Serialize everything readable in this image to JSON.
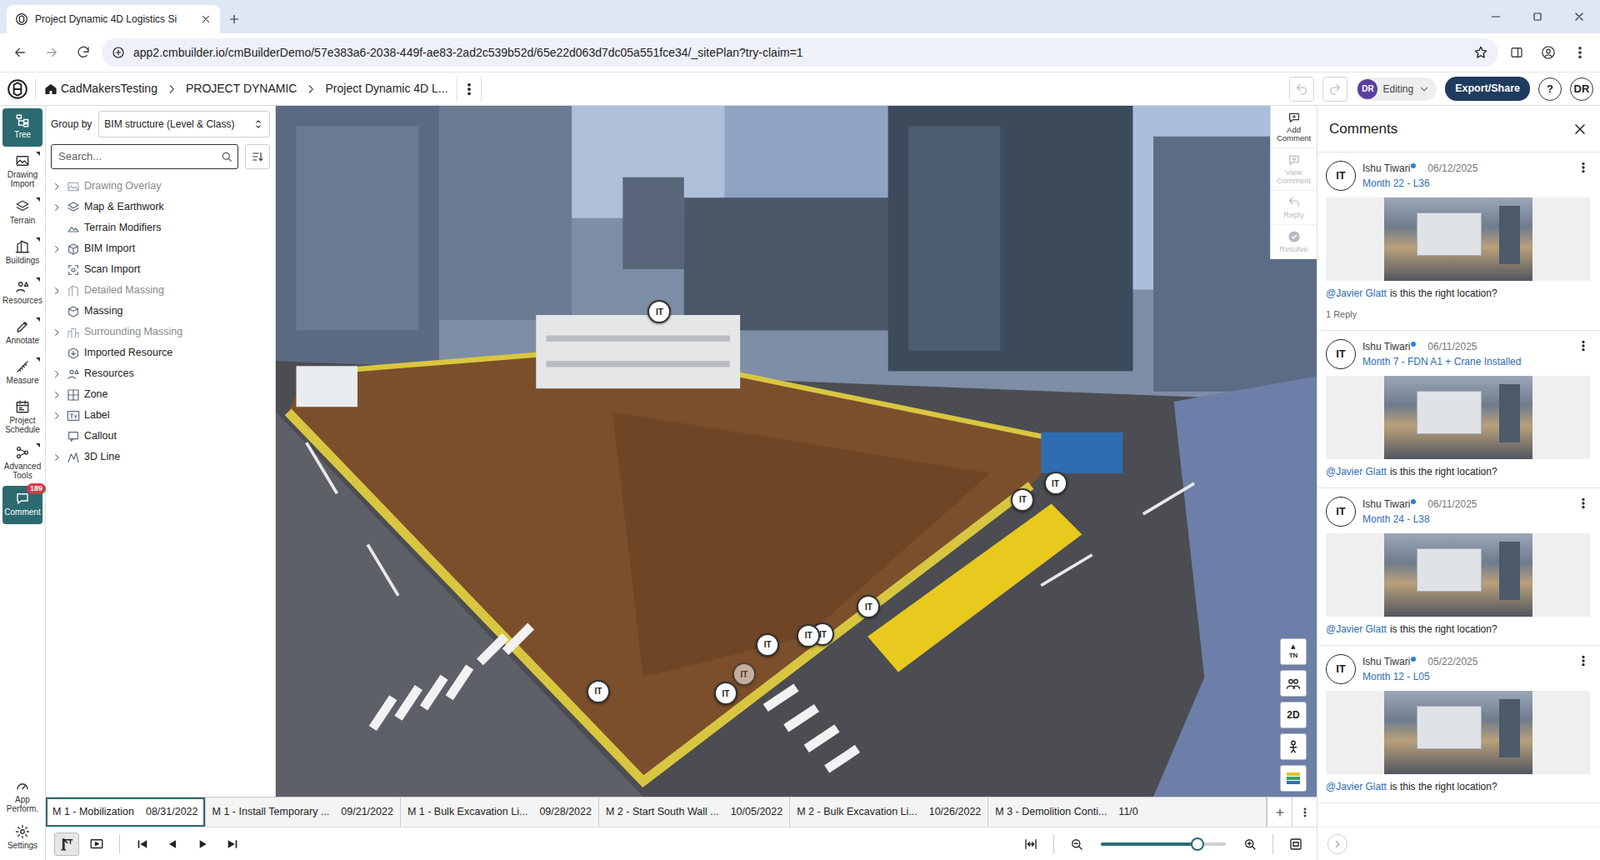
{
  "browser": {
    "tab": {
      "title": "Project Dynamic 4D Logistics Si",
      "selected": true
    },
    "url": "app2.cmbuilder.io/cmBuilderDemo/57e383a6-2038-449f-ae83-2ad2c539b52d/65e22d063d7dc05a551fce34/_sitePlan?try-claim=1"
  },
  "header": {
    "breadcrumb": [
      "CadMakersTesting",
      "PROJECT DYNAMIC",
      "Project Dynamic 4D L..."
    ],
    "undo": {
      "disabled": true
    },
    "redo": {
      "disabled": true
    },
    "mode": {
      "initials": "DR",
      "label": "Editing"
    },
    "export_label": "Export/Share",
    "help_label": "?",
    "account_initials": "DR"
  },
  "rail": {
    "items": [
      {
        "label": "Tree",
        "selected": true,
        "has_menu": false
      },
      {
        "label": "Drawing Import",
        "selected": false,
        "has_menu": true
      },
      {
        "label": "Terrain",
        "selected": false,
        "has_menu": true
      },
      {
        "label": "Buildings",
        "selected": false,
        "has_menu": true
      },
      {
        "label": "Resources",
        "selected": false,
        "has_menu": true
      },
      {
        "label": "Annotate",
        "selected": false,
        "has_menu": true
      },
      {
        "label": "Measure",
        "selected": false,
        "has_menu": true
      },
      {
        "label": "Project Schedule",
        "selected": false,
        "has_menu": false
      },
      {
        "label": "Advanced Tools",
        "selected": false,
        "has_menu": true
      },
      {
        "label": "Comment",
        "selected": true,
        "has_menu": false,
        "badge": "189"
      }
    ],
    "bottom_items": [
      {
        "label": "App Perform.",
        "selected": false,
        "has_menu": false
      },
      {
        "label": "Settings",
        "selected": false,
        "has_menu": false
      }
    ]
  },
  "tree": {
    "group_by_label": "Group by",
    "group_by_value": "BIM structure (Level & Class)",
    "search_placeholder": "Search...",
    "items": [
      {
        "label": "Drawing Overlay",
        "expandable": true,
        "disabled": true
      },
      {
        "label": "Map & Earthwork",
        "expandable": true,
        "disabled": false
      },
      {
        "label": "Terrain Modifiers",
        "expandable": false,
        "disabled": false
      },
      {
        "label": "BIM Import",
        "expandable": true,
        "disabled": false
      },
      {
        "label": "Scan Import",
        "expandable": false,
        "disabled": false
      },
      {
        "label": "Detailed Massing",
        "expandable": true,
        "disabled": true
      },
      {
        "label": "Massing",
        "expandable": false,
        "disabled": false
      },
      {
        "label": "Surrounding Massing",
        "expandable": true,
        "disabled": true
      },
      {
        "label": "Imported Resource",
        "expandable": false,
        "disabled": false
      },
      {
        "label": "Resources",
        "expandable": true,
        "disabled": false
      },
      {
        "label": "Zone",
        "expandable": true,
        "disabled": false
      },
      {
        "label": "Label",
        "expandable": true,
        "disabled": false
      },
      {
        "label": "Callout",
        "expandable": false,
        "disabled": false
      },
      {
        "label": "3D Line",
        "expandable": true,
        "disabled": false
      }
    ]
  },
  "viewport": {
    "tools": [
      {
        "label": "Add Comment",
        "disabled": false
      },
      {
        "label": "View Comment",
        "disabled": true
      },
      {
        "label": "Reply",
        "disabled": true
      },
      {
        "label": "Resolve",
        "disabled": true
      }
    ],
    "pins": [
      {
        "label": "IT",
        "dimmed": false
      },
      {
        "label": "IT",
        "dimmed": false
      },
      {
        "label": "IT",
        "dimmed": false
      },
      {
        "label": "IT",
        "dimmed": false
      },
      {
        "label": "IT",
        "dimmed": false
      },
      {
        "label": "IT",
        "dimmed": false
      },
      {
        "label": "IT",
        "dimmed": false
      },
      {
        "label": "IT",
        "dimmed": true
      },
      {
        "label": "IT",
        "dimmed": false
      },
      {
        "label": "IT",
        "dimmed": false
      }
    ],
    "corner_buttons": [
      {
        "kind": "compass",
        "label": "TN"
      },
      {
        "kind": "icon"
      },
      {
        "kind": "text",
        "label": "2D"
      },
      {
        "kind": "icon"
      },
      {
        "kind": "icon"
      }
    ]
  },
  "comments": {
    "title": "Comments",
    "items": [
      {
        "author": "Ishu Tiwari",
        "initials": "IT",
        "online": true,
        "date": "06/12/2025",
        "subtitle": "Month 22 - L36",
        "mention": "@Javier Glatt",
        "body": "is this the right location?",
        "replies": "1 Reply"
      },
      {
        "author": "Ishu Tiwari",
        "initials": "IT",
        "online": true,
        "date": "06/11/2025",
        "subtitle": "Month 7 - FDN A1 + Crane Installed",
        "mention": "@Javier Glatt",
        "body": "is this the right location?"
      },
      {
        "author": "Ishu Tiwari",
        "initials": "IT",
        "online": true,
        "date": "06/11/2025",
        "subtitle": "Month 24 - L38",
        "mention": "@Javier Glatt",
        "body": "is this the right location?"
      },
      {
        "author": "Ishu Tiwari",
        "initials": "IT",
        "online": true,
        "date": "05/22/2025",
        "subtitle": "Month 12 - L05",
        "mention": "@Javier Glatt",
        "body": "is this the right location?"
      }
    ]
  },
  "timeline": {
    "items": [
      {
        "label": "M 1 - Mobilization",
        "date": "08/31/2022",
        "selected": true
      },
      {
        "label": "M 1 - Install Temporary ...",
        "date": "09/21/2022",
        "selected": false
      },
      {
        "label": "M 1 - Bulk Excavation Li...",
        "date": "09/28/2022",
        "selected": false
      },
      {
        "label": "M 2 - Start South Wall ...",
        "date": "10/05/2022",
        "selected": false
      },
      {
        "label": "M 2 - Bulk Excavation Li...",
        "date": "10/26/2022",
        "selected": false
      },
      {
        "label": "M 3 - Demolition Conti...",
        "date": "11/0",
        "selected": false
      }
    ]
  },
  "toolbar": {
    "views": [
      {
        "selected": true
      },
      {
        "selected": false
      }
    ],
    "zoom_level": 0.77
  }
}
